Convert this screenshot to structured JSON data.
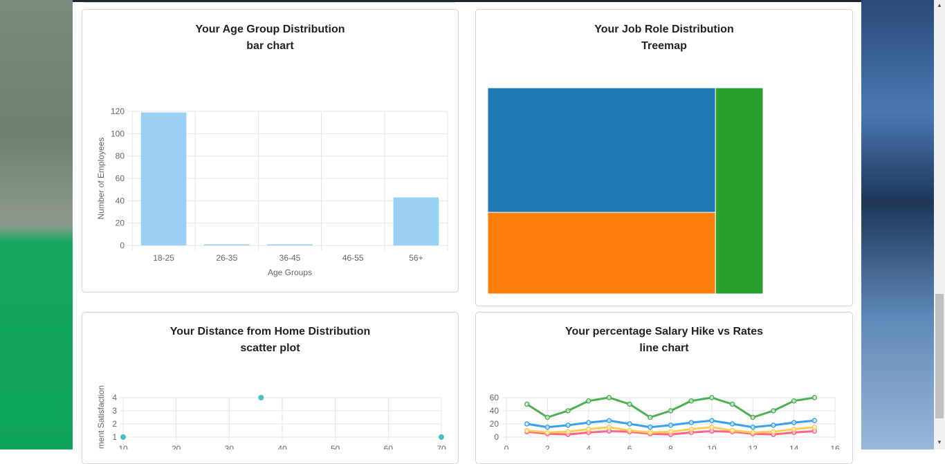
{
  "colors": {
    "bar_fill": "#9ad0f5",
    "grid": "#e5e5e5",
    "axis_text": "#666666",
    "treemap": [
      "#1f77b4",
      "#ff7f0e",
      "#2ca02c"
    ],
    "scatter_point": "#4bc0c0",
    "line_series": [
      "#4caf50",
      "#36a2eb",
      "#ffcd56",
      "#ff6384"
    ]
  },
  "cards": {
    "age": {
      "title": "Your Age Group Distribution",
      "subtitle": "bar chart"
    },
    "job": {
      "title": "Your Job Role Distribution",
      "subtitle": "Treemap"
    },
    "distance": {
      "title": "Your Distance from Home Distribution",
      "subtitle": "scatter plot"
    },
    "salary": {
      "title": "Your percentage Salary Hike vs Rates",
      "subtitle": "line chart"
    }
  },
  "chart_data": [
    {
      "type": "bar",
      "categories": [
        "18-25",
        "26-35",
        "36-45",
        "46-55",
        "56+"
      ],
      "values": [
        119,
        1,
        1,
        0,
        43
      ],
      "xlabel": "Age Groups",
      "ylabel": "Number of Employees",
      "ylim": [
        0,
        120
      ],
      "yticks": [
        0,
        20,
        40,
        60,
        80,
        100,
        120
      ],
      "grid": true
    },
    {
      "type": "treemap",
      "values": [
        55,
        36,
        19
      ]
    },
    {
      "type": "scatter",
      "points": [
        [
          10,
          1
        ],
        [
          36,
          4
        ],
        [
          70,
          1
        ]
      ],
      "ylabel": "Environment Satisfaction",
      "xlim": [
        10,
        70
      ],
      "ylim": [
        1,
        4
      ],
      "xticks": [
        10,
        20,
        30,
        40,
        50,
        60,
        70
      ],
      "yticks": [
        1,
        2,
        3,
        4
      ],
      "grid": true
    },
    {
      "type": "line",
      "x": [
        1,
        2,
        3,
        4,
        5,
        6,
        7,
        8,
        9,
        10,
        11,
        12,
        13,
        14,
        15
      ],
      "xlim": [
        0,
        16
      ],
      "ylim": [
        0,
        60
      ],
      "xticks": [
        0,
        2,
        4,
        6,
        8,
        10,
        12,
        14,
        16
      ],
      "yticks": [
        0,
        20,
        40,
        60
      ],
      "grid": true,
      "series": [
        {
          "values": [
            50,
            30,
            40,
            55,
            60,
            50,
            30,
            40,
            55,
            60,
            50,
            30,
            40,
            55,
            60
          ]
        },
        {
          "values": [
            20,
            15,
            18,
            22,
            25,
            20,
            15,
            18,
            22,
            25,
            20,
            15,
            18,
            22,
            25
          ]
        },
        {
          "values": [
            10,
            7,
            8,
            12,
            15,
            10,
            7,
            8,
            12,
            15,
            10,
            7,
            8,
            12,
            15
          ]
        },
        {
          "values": [
            8,
            5,
            4,
            7,
            9,
            8,
            5,
            4,
            7,
            9,
            8,
            5,
            4,
            7,
            9
          ]
        }
      ]
    }
  ]
}
